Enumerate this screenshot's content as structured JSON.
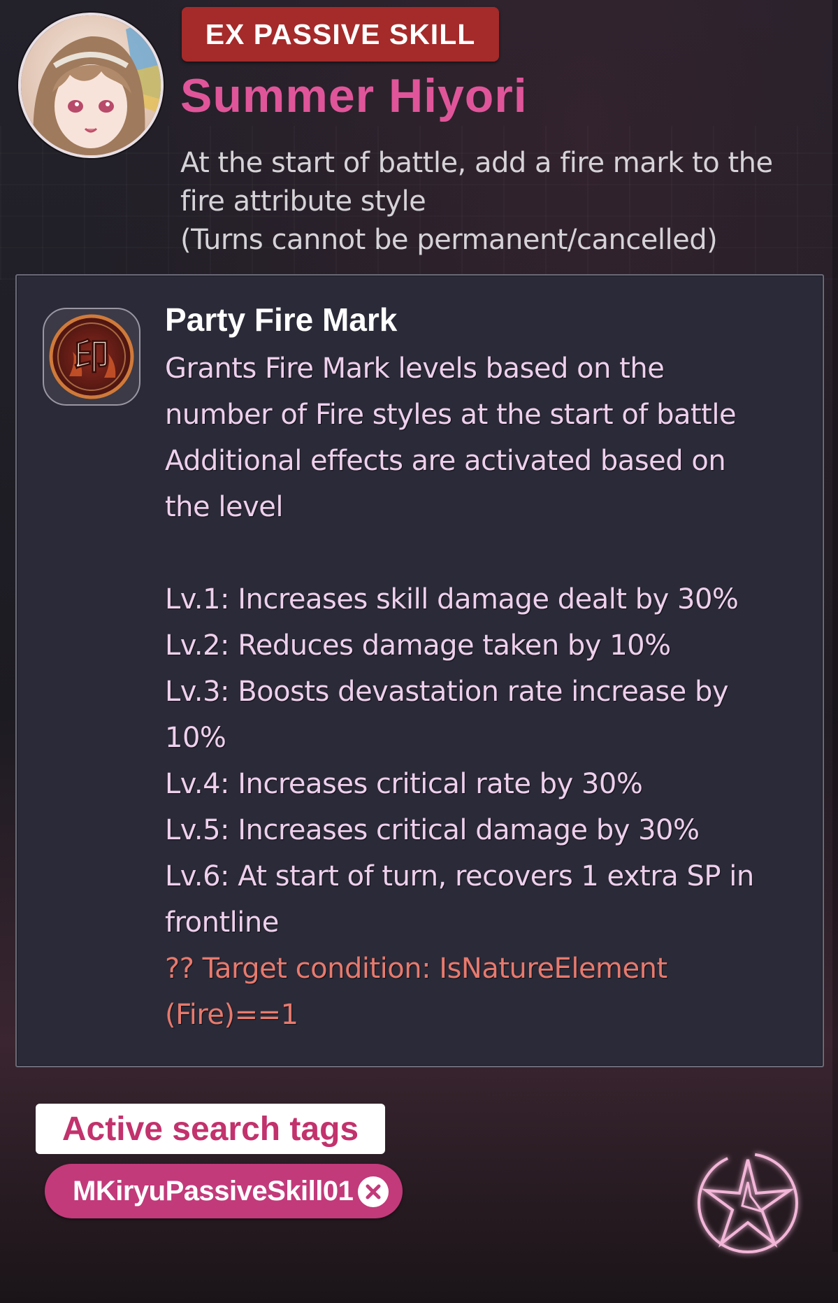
{
  "header": {
    "badge": "EX PASSIVE SKILL",
    "character_name": "Summer Hiyori",
    "description_lines": [
      "At the start of battle, add a fire mark to the",
      "fire attribute style",
      "(Turns cannot be permanent/cancelled)"
    ]
  },
  "skill": {
    "title": "Party Fire Mark",
    "icon": "fire-mark-seal-icon",
    "icon_glyph": "印",
    "lines": [
      "Grants Fire Mark levels based on the",
      "number of Fire styles at the start of battle",
      "Additional effects are activated based on",
      "the level"
    ],
    "levels": [
      "Lv.1: Increases skill damage dealt by 30%",
      "Lv.2: Reduces damage taken by 10%",
      "Lv.3: Boosts devastation rate increase by",
      "10%",
      "Lv.4: Increases critical rate by 30%",
      "Lv.5: Increases critical damage by 30%",
      "Lv.6: At start of turn, recovers 1 extra SP in",
      "frontline"
    ],
    "condition_lines": [
      "?? Target condition: IsNatureElement",
      "(Fire)==1"
    ]
  },
  "search": {
    "label": "Active search tags",
    "tags": [
      "MKiryuPassiveSkill01"
    ]
  },
  "colors": {
    "badge_bg": "#a52a2a",
    "name_pink": "#e0559a",
    "skill_text": "#eed0ec",
    "condition_text": "#e77a6e",
    "tag_bg": "#c23a7a"
  }
}
